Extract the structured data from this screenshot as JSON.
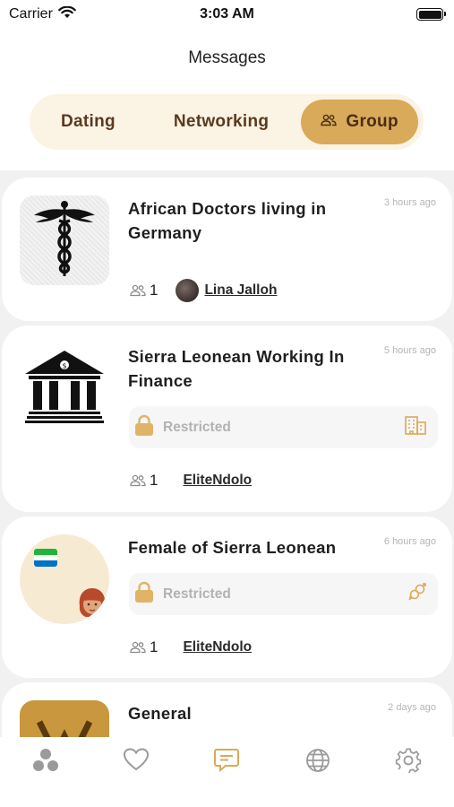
{
  "status_bar": {
    "carrier": "Carrier",
    "time": "3:03 AM"
  },
  "header": {
    "title": "Messages"
  },
  "tabs": [
    {
      "label": "Dating",
      "selected": false
    },
    {
      "label": "Networking",
      "selected": false
    },
    {
      "label": "Group",
      "selected": true,
      "icon": "group-icon"
    }
  ],
  "groups": [
    {
      "title": "African Doctors living in Germany",
      "time": "3 hours ago",
      "image": "caduceus-icon",
      "members": "1",
      "owner": "Lina Jalloh",
      "restricted": false
    },
    {
      "title": "Sierra Leonean Working In Finance",
      "time": "5 hours ago",
      "image": "bank-icon",
      "members": "1",
      "owner": "EliteNdolo",
      "restricted": true,
      "restricted_label": "Restricted",
      "restricted_icon": "building-icon"
    },
    {
      "title": "Female of Sierra Leonean",
      "time": "6 hours ago",
      "image": "flag-woman-avatar",
      "members": "1",
      "owner": "EliteNdolo",
      "restricted": true,
      "restricted_label": "Restricted",
      "restricted_icon": "gender-icon"
    },
    {
      "title": "General",
      "time": "2 days ago",
      "image": "general-logo"
    }
  ],
  "bottom_nav": [
    {
      "icon": "people-dots-icon"
    },
    {
      "icon": "heart-icon"
    },
    {
      "icon": "chat-icon",
      "active": true
    },
    {
      "icon": "globe-icon"
    },
    {
      "icon": "settings-gear-icon"
    }
  ],
  "colors": {
    "accent": "#d9aa5a",
    "tab_bg": "#fbf3e3",
    "list_bg": "#f1f1f1",
    "muted": "#b5b5b5"
  }
}
